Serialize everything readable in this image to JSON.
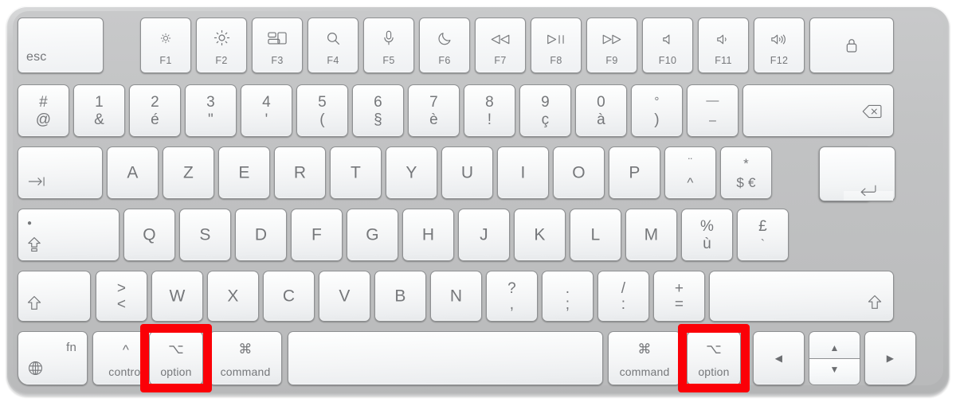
{
  "device": {
    "name": "Apple Magic Keyboard",
    "layout": "AZERTY (French)",
    "body_color": "#c3c4c5",
    "key_color": "#f4f5f6",
    "key_border_color": "#8e9092",
    "legend_color": "#75777a",
    "highlight_color": "#fb0007"
  },
  "annotations": {
    "highlights": [
      {
        "target": "option-key-left",
        "label": "option",
        "color": "#fb0007"
      },
      {
        "target": "option-key-right",
        "label": "option",
        "color": "#fb0007"
      }
    ]
  },
  "rows": {
    "function_row": [
      {
        "name": "esc",
        "label": "esc",
        "icon": ""
      },
      {
        "name": "f1",
        "label": "F1",
        "icon": "brightness-low-icon"
      },
      {
        "name": "f2",
        "label": "F2",
        "icon": "brightness-high-icon"
      },
      {
        "name": "f3",
        "label": "F3",
        "icon": "mission-control-icon"
      },
      {
        "name": "f4",
        "label": "F4",
        "icon": "spotlight-search-icon"
      },
      {
        "name": "f5",
        "label": "F5",
        "icon": "dictation-microphone-icon"
      },
      {
        "name": "f6",
        "label": "F6",
        "icon": "do-not-disturb-moon-icon"
      },
      {
        "name": "f7",
        "label": "F7",
        "icon": "media-rewind-icon"
      },
      {
        "name": "f8",
        "label": "F8",
        "icon": "media-play-pause-icon"
      },
      {
        "name": "f9",
        "label": "F9",
        "icon": "media-fast-forward-icon"
      },
      {
        "name": "f10",
        "label": "F10",
        "icon": "volume-mute-icon"
      },
      {
        "name": "f11",
        "label": "F11",
        "icon": "volume-down-icon"
      },
      {
        "name": "f12",
        "label": "F12",
        "icon": "volume-up-icon"
      },
      {
        "name": "touch-id",
        "label": "",
        "icon": "lock-touch-id-icon"
      }
    ],
    "number_row": [
      {
        "name": "key-hash-at",
        "upper": "#",
        "lower": "@"
      },
      {
        "name": "key-1-ampersand",
        "upper": "1",
        "lower": "&"
      },
      {
        "name": "key-2-eacute",
        "upper": "2",
        "lower": "é"
      },
      {
        "name": "key-3-quote",
        "upper": "3",
        "lower": "\""
      },
      {
        "name": "key-4-apostrophe",
        "upper": "4",
        "lower": "'"
      },
      {
        "name": "key-5-parenleft",
        "upper": "5",
        "lower": "("
      },
      {
        "name": "key-6-section",
        "upper": "6",
        "lower": "§"
      },
      {
        "name": "key-7-egrave",
        "upper": "7",
        "lower": "è"
      },
      {
        "name": "key-8-exclam",
        "upper": "8",
        "lower": "!"
      },
      {
        "name": "key-9-ccedilla",
        "upper": "9",
        "lower": "ç"
      },
      {
        "name": "key-0-agrave",
        "upper": "0",
        "lower": "à"
      },
      {
        "name": "key-degree-parenright",
        "upper": "°",
        "lower": ")"
      },
      {
        "name": "key-underscore-minus",
        "upper": "—",
        "lower": "–"
      },
      {
        "name": "delete",
        "upper": "",
        "lower": "",
        "icon": "delete-backspace-icon"
      }
    ],
    "top_letter_row": [
      {
        "name": "tab",
        "label": "",
        "icon": "tab-arrow-icon"
      },
      {
        "name": "key-a",
        "label": "A"
      },
      {
        "name": "key-z",
        "label": "Z"
      },
      {
        "name": "key-e",
        "label": "E"
      },
      {
        "name": "key-r",
        "label": "R"
      },
      {
        "name": "key-t",
        "label": "T"
      },
      {
        "name": "key-y",
        "label": "Y"
      },
      {
        "name": "key-u",
        "label": "U"
      },
      {
        "name": "key-i",
        "label": "I"
      },
      {
        "name": "key-o",
        "label": "O"
      },
      {
        "name": "key-p",
        "label": "P"
      },
      {
        "name": "key-diaeresis-circumflex",
        "upper": "¨",
        "lower": "^"
      },
      {
        "name": "key-asterisk-dollar-euro",
        "upper": "*",
        "lower": "$ €"
      },
      {
        "name": "return",
        "label": "",
        "icon": "return-enter-icon"
      }
    ],
    "home_row": [
      {
        "name": "caps-lock",
        "label": "",
        "icon": "caps-lock-icon"
      },
      {
        "name": "key-q",
        "label": "Q"
      },
      {
        "name": "key-s",
        "label": "S"
      },
      {
        "name": "key-d",
        "label": "D"
      },
      {
        "name": "key-f",
        "label": "F"
      },
      {
        "name": "key-g",
        "label": "G"
      },
      {
        "name": "key-h",
        "label": "H"
      },
      {
        "name": "key-j",
        "label": "J"
      },
      {
        "name": "key-k",
        "label": "K"
      },
      {
        "name": "key-l",
        "label": "L"
      },
      {
        "name": "key-m",
        "label": "M"
      },
      {
        "name": "key-percent-ugrave",
        "upper": "%",
        "lower": "ù"
      },
      {
        "name": "key-sterling-grave",
        "upper": "£",
        "lower": "`"
      }
    ],
    "shift_row": [
      {
        "name": "shift-left",
        "label": "",
        "icon": "shift-arrow-icon"
      },
      {
        "name": "key-greater-less",
        "upper": ">",
        "lower": "<"
      },
      {
        "name": "key-w",
        "label": "W"
      },
      {
        "name": "key-x",
        "label": "X"
      },
      {
        "name": "key-c",
        "label": "C"
      },
      {
        "name": "key-v",
        "label": "V"
      },
      {
        "name": "key-b",
        "label": "B"
      },
      {
        "name": "key-n",
        "label": "N"
      },
      {
        "name": "key-question-comma",
        "upper": "?",
        "lower": ","
      },
      {
        "name": "key-period-semicolon",
        "upper": ".",
        "lower": ";"
      },
      {
        "name": "key-slash-colon",
        "upper": "/",
        "lower": ":"
      },
      {
        "name": "key-plus-equals",
        "upper": "+",
        "lower": "="
      },
      {
        "name": "shift-right",
        "label": "",
        "icon": "shift-arrow-icon"
      }
    ],
    "modifier_row": [
      {
        "name": "fn-globe",
        "word": "fn",
        "glyph": "globe-icon"
      },
      {
        "name": "control-key",
        "word": "control",
        "glyph": "^"
      },
      {
        "name": "option-key-left",
        "word": "option",
        "glyph": "⌥",
        "highlighted": true
      },
      {
        "name": "command-key-left",
        "word": "command",
        "glyph": "⌘"
      },
      {
        "name": "space-bar",
        "word": "",
        "glyph": ""
      },
      {
        "name": "command-key-right",
        "word": "command",
        "glyph": "⌘"
      },
      {
        "name": "option-key-right",
        "word": "option",
        "glyph": "⌥",
        "highlighted": true
      },
      {
        "name": "arrow-left",
        "word": "",
        "glyph": "◀"
      },
      {
        "name": "arrow-up",
        "word": "",
        "glyph": "▲"
      },
      {
        "name": "arrow-down",
        "word": "",
        "glyph": "▼"
      },
      {
        "name": "arrow-right",
        "word": "",
        "glyph": "▶"
      }
    ]
  }
}
